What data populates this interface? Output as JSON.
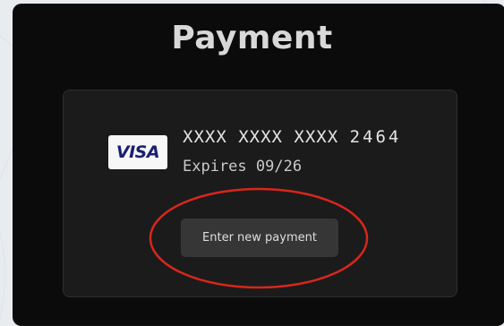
{
  "title": "Payment",
  "card": {
    "brand": "VISA",
    "number_masked": "XXXX XXXX XXXX",
    "last4": "2464",
    "expires": "Expires 09/26"
  },
  "actions": {
    "enter_new_payment": "Enter new payment"
  },
  "colors": {
    "panel": "#0b0b0b",
    "card": "#1b1b1b",
    "button": "#363636",
    "visa_blue": "#1a1f71",
    "annotation_red": "#d8261c"
  }
}
